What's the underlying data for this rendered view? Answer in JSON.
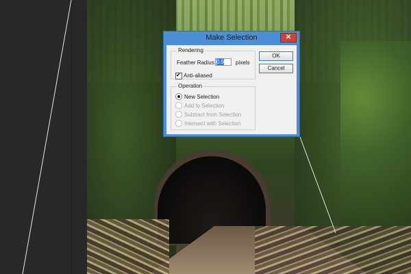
{
  "dialog": {
    "title": "Make Selection",
    "close_glyph": "✕",
    "rendering": {
      "legend": "Rendering",
      "feather_label": "Feather Radius:",
      "feather_value": "0.9",
      "feather_unit": "pixels",
      "antialiased_label": "Anti-aliased",
      "antialiased_checked": true
    },
    "operation": {
      "legend": "Operation",
      "options": [
        {
          "label": "New Selection",
          "selected": true,
          "enabled": true
        },
        {
          "label": "Add to Selection",
          "selected": false,
          "enabled": false
        },
        {
          "label": "Subtract from Selection",
          "selected": false,
          "enabled": false
        },
        {
          "label": "Intersect with Selection",
          "selected": false,
          "enabled": false
        }
      ]
    },
    "buttons": {
      "ok": "OK",
      "cancel": "Cancel"
    }
  },
  "colors": {
    "workspace": "#282828",
    "title_bar": "#4a8fd8",
    "close_button": "#c9453a",
    "dialog_body": "#f0f0f0"
  },
  "icons": {
    "close": "close-icon",
    "checkbox": "checkbox-icon",
    "radio": "radio-icon"
  }
}
